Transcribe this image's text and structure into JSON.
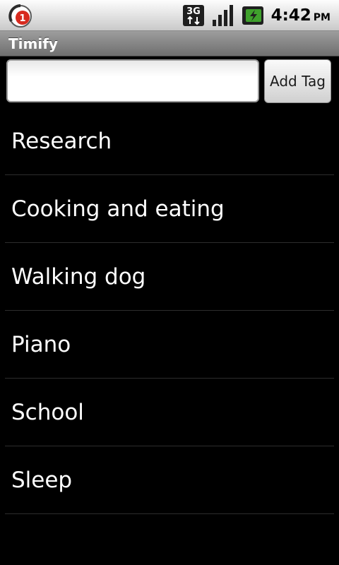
{
  "status_bar": {
    "notification_count": "1",
    "network_type": "3G",
    "time": "4:42",
    "ampm": "PM"
  },
  "app": {
    "title": "Timify"
  },
  "tag_form": {
    "input_value": "",
    "input_placeholder": "",
    "add_button_label": "Add Tag"
  },
  "tags": {
    "items": [
      {
        "label": "Research"
      },
      {
        "label": "Cooking and eating"
      },
      {
        "label": "Walking dog"
      },
      {
        "label": "Piano"
      },
      {
        "label": "School"
      },
      {
        "label": "Sleep"
      }
    ]
  },
  "colors": {
    "background": "#000000",
    "text": "#ffffff",
    "notification_badge": "#d72b1f",
    "battery_fill": "#3fa12c"
  }
}
